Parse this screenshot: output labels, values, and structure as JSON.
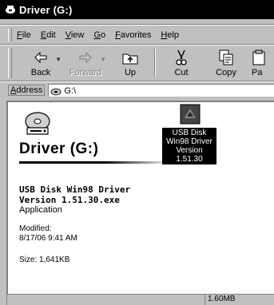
{
  "window": {
    "title": "Driver (G:)"
  },
  "menu": {
    "items": [
      "File",
      "Edit",
      "View",
      "Go",
      "Favorites",
      "Help"
    ]
  },
  "toolbar": {
    "buttons": [
      {
        "label": "Back",
        "icon": "back-arrow-icon",
        "enabled": true
      },
      {
        "label": "Forward",
        "icon": "forward-arrow-icon",
        "enabled": false
      },
      {
        "label": "Up",
        "icon": "up-folder-icon",
        "enabled": true
      },
      {
        "label": "Cut",
        "icon": "scissors-icon",
        "enabled": true
      },
      {
        "label": "Copy",
        "icon": "copy-icon",
        "enabled": true
      },
      {
        "label": "Pa",
        "icon": "paste-icon",
        "enabled": true
      }
    ]
  },
  "address": {
    "label": "Address",
    "value": "G:\\"
  },
  "panel": {
    "drive_title": "Driver (G:)",
    "file_name": "USB Disk Win98 Driver Version 1.51.30.exe",
    "file_type": "Application",
    "modified_label": "Modified:",
    "modified_value": "8/17/06 9:41 AM",
    "size_text": "Size: 1,641KB"
  },
  "file_item": {
    "caption": "USB Disk Win98 Driver Version 1.51.30",
    "caption_lines": [
      "USB Disk",
      "Win98 Driver",
      "Version",
      "1.51.30"
    ]
  },
  "status": {
    "size": "1.60MB"
  },
  "colors": {
    "title_bg": "#000000",
    "face": "#c0c0c0",
    "content_bg": "#ffffff",
    "selection_bg": "#000000"
  }
}
